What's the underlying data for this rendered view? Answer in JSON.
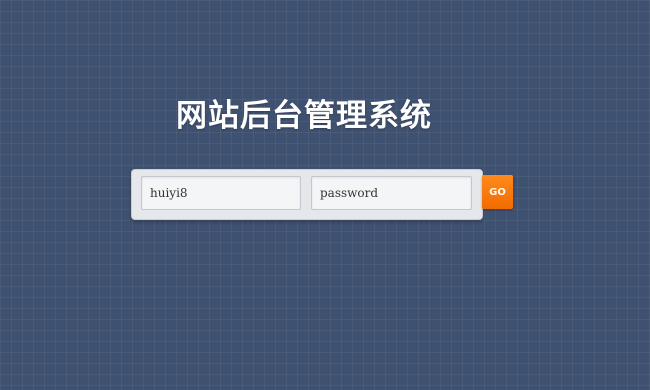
{
  "header": {
    "title": "网站后台管理系统"
  },
  "login_form": {
    "username_value": "huiyi8",
    "password_placeholder": "password",
    "submit_label": "GO"
  },
  "colors": {
    "background": "#3f5170",
    "panel": "#e5e7ea",
    "input_bg": "#f4f5f7",
    "accent": "#f47a0c",
    "title_text": "#ffffff"
  }
}
